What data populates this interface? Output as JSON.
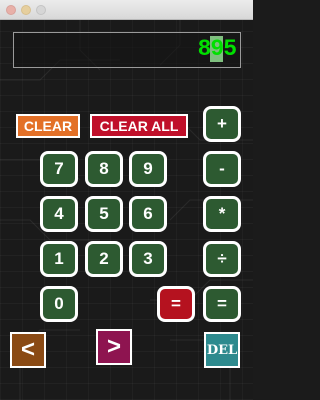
{
  "display": {
    "value_main": "8",
    "value_cursor": "9",
    "value_tail": "5"
  },
  "buttons": {
    "clear": "CLEAR",
    "clear_all": "CLEAR ALL",
    "plus": "+",
    "minus": "-",
    "multiply": "*",
    "divide": "÷",
    "equals_right": "=",
    "equals_red": "=",
    "d7": "7",
    "d8": "8",
    "d9": "9",
    "d4": "4",
    "d5": "5",
    "d6": "6",
    "d1": "1",
    "d2": "2",
    "d3": "3",
    "d0": "0",
    "back": "<",
    "forward": ">",
    "del": "DEL"
  },
  "colors": {
    "display_text": "#00e000",
    "digit_button": "#2d5a31",
    "clear_button": "#e37027",
    "clear_all_button": "#c0102a",
    "back_button": "#8a4a14",
    "forward_button": "#8e1450",
    "del_button": "#2d8a8e"
  }
}
